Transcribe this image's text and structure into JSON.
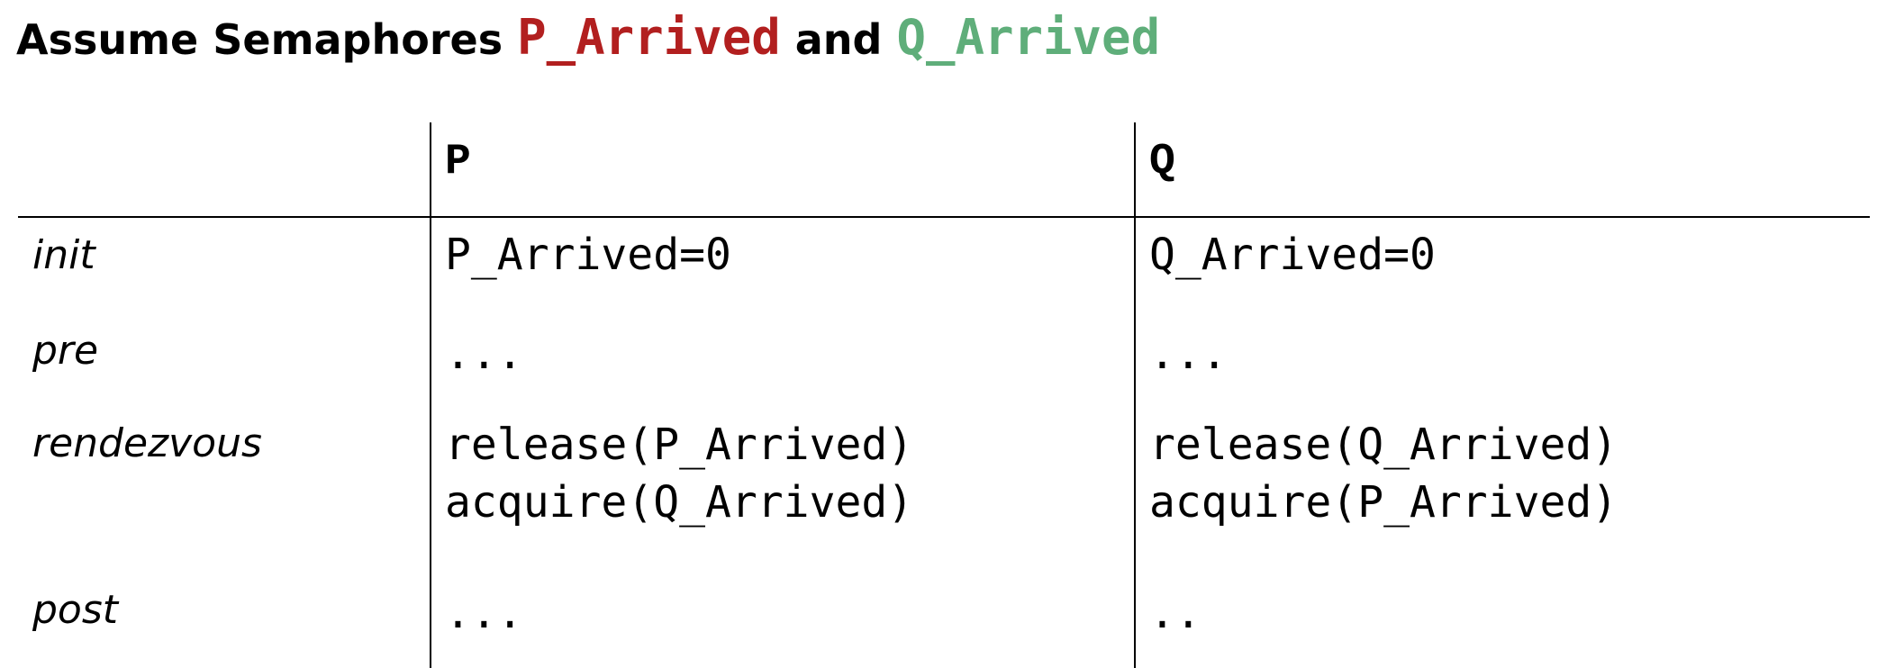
{
  "title": {
    "prefix": "Assume Semaphores",
    "sem1": "P_Arrived",
    "middle": "and",
    "sem2": "Q_Arrived"
  },
  "table": {
    "columns": [
      "",
      "P",
      "Q"
    ],
    "rows": [
      {
        "label": "init",
        "p": [
          "P_Arrived=0"
        ],
        "q": [
          "Q_Arrived=0"
        ]
      },
      {
        "label": "pre",
        "p": [
          "..."
        ],
        "q": [
          "..."
        ]
      },
      {
        "label": "rendezvous",
        "p": [
          "release(P_Arrived)",
          "acquire(Q_Arrived)"
        ],
        "q": [
          "release(Q_Arrived)",
          "acquire(P_Arrived)"
        ]
      },
      {
        "label": "post",
        "p": [
          "..."
        ],
        "q": [
          ".."
        ]
      }
    ]
  },
  "colors": {
    "p_arrived": "#b21f1f",
    "q_arrived": "#5fae7a",
    "text": "#000000"
  }
}
